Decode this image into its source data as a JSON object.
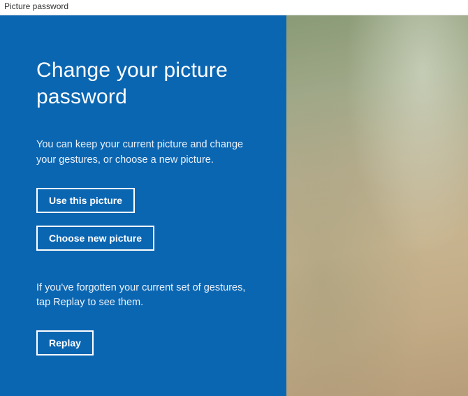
{
  "window": {
    "title": "Picture password"
  },
  "panel": {
    "heading": "Change your picture password",
    "description": "You can keep your current picture and change your gestures, or choose a new picture.",
    "use_this_picture_label": "Use this picture",
    "choose_new_picture_label": "Choose new picture",
    "replay_hint": "If you've forgotten your current set of gestures, tap Replay to see them.",
    "replay_label": "Replay"
  }
}
